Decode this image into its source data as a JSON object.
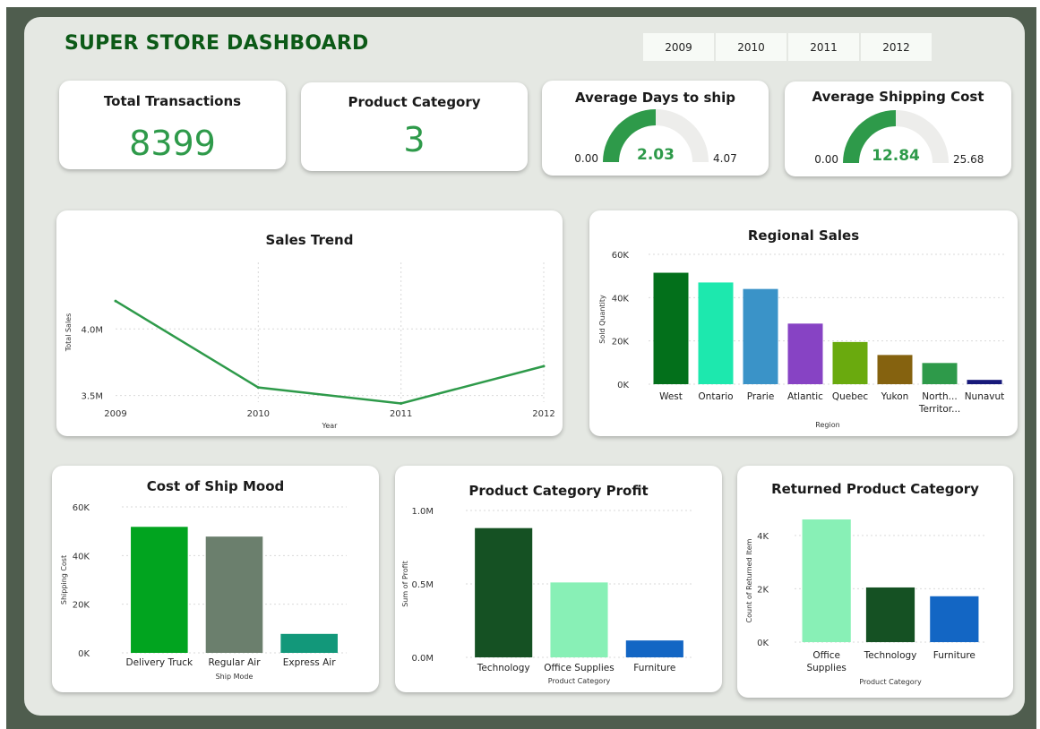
{
  "header": {
    "title": "SUPER STORE DASHBOARD",
    "years": [
      "2009",
      "2010",
      "2011",
      "2012"
    ]
  },
  "kpis": {
    "total_transactions": {
      "label": "Total Transactions",
      "value": "8399"
    },
    "product_category": {
      "label": "Product Category",
      "value": "3"
    },
    "avg_days_to_ship": {
      "label": "Average Days to ship",
      "value": "2.03",
      "min": "0.00",
      "max": "4.07",
      "fraction": 0.5
    },
    "avg_shipping_cost": {
      "label": "Average Shipping Cost",
      "value": "12.84",
      "min": "0.00",
      "max": "25.68",
      "fraction": 0.5
    }
  },
  "colors": {
    "accent": "#2e9a4a",
    "title": "#0c5a17",
    "frame": "#4f5d4e",
    "canvas": "#e5e8e3"
  },
  "chart_data": [
    {
      "id": "sales_trend",
      "type": "line",
      "title": "Sales Trend",
      "xlabel": "Year",
      "ylabel": "Total Sales",
      "x": [
        "2009",
        "2010",
        "2011",
        "2012"
      ],
      "values": [
        4.21,
        3.56,
        3.44,
        3.72
      ],
      "ylim": [
        3.45,
        4.5
      ],
      "yticks": [
        {
          "v": 3.5,
          "label": "3.5M"
        },
        {
          "v": 4.0,
          "label": "4.0M"
        }
      ],
      "color": "#2e9a4a",
      "grid": true
    },
    {
      "id": "regional_sales",
      "type": "bar",
      "title": "Regional Sales",
      "xlabel": "Region",
      "ylabel": "Sold Quantity",
      "categories": [
        "West",
        "Ontario",
        "Prarie",
        "Atlantic",
        "Quebec",
        "Yukon",
        "North... Territor...",
        "Nunavut"
      ],
      "values": [
        51500,
        47000,
        44000,
        28000,
        19500,
        13500,
        9800,
        2000
      ],
      "colors": [
        "#03701b",
        "#1de8ae",
        "#3a93c8",
        "#8743c4",
        "#6aaa0e",
        "#85620f",
        "#2e9a4a",
        "#17197a"
      ],
      "ylim": [
        0,
        60000
      ],
      "yticks": [
        {
          "v": 0,
          "label": "0K"
        },
        {
          "v": 20000,
          "label": "20K"
        },
        {
          "v": 40000,
          "label": "40K"
        },
        {
          "v": 60000,
          "label": "60K"
        }
      ]
    },
    {
      "id": "cost_of_ship_mode",
      "type": "bar",
      "title": "Cost of Ship Mood",
      "xlabel": "Ship Mode",
      "ylabel": "Shipping Cost",
      "categories": [
        "Delivery Truck",
        "Regular Air",
        "Express Air"
      ],
      "values": [
        51800,
        47800,
        7800
      ],
      "colors": [
        "#01a41f",
        "#6b7f6d",
        "#12987a"
      ],
      "ylim": [
        0,
        60000
      ],
      "yticks": [
        {
          "v": 0,
          "label": "0K"
        },
        {
          "v": 20000,
          "label": "20K"
        },
        {
          "v": 40000,
          "label": "40K"
        },
        {
          "v": 60000,
          "label": "60K"
        }
      ]
    },
    {
      "id": "product_category_profit",
      "type": "bar",
      "title": "Product Category Profit",
      "xlabel": "Product Category",
      "ylabel": "Sum of Profit",
      "categories": [
        "Technology",
        "Office Supplies",
        "Furniture"
      ],
      "values": [
        880000,
        510000,
        115000
      ],
      "colors": [
        "#155123",
        "#88f0b6",
        "#1366c4"
      ],
      "ylim": [
        0,
        1000000
      ],
      "yticks": [
        {
          "v": 0,
          "label": "0.0M"
        },
        {
          "v": 500000,
          "label": "0.5M"
        },
        {
          "v": 1000000,
          "label": "1.0M"
        }
      ]
    },
    {
      "id": "returned_product_category",
      "type": "bar",
      "title": "Returned Product Category",
      "xlabel": "Product Category",
      "ylabel": "Count of Returned Item",
      "categories": [
        "Office Supplies",
        "Technology",
        "Furniture"
      ],
      "values": [
        4600,
        2050,
        1720
      ],
      "colors": [
        "#88f0b6",
        "#155123",
        "#1366c4"
      ],
      "ylim": [
        0,
        4600
      ],
      "yticks": [
        {
          "v": 0,
          "label": "0K"
        },
        {
          "v": 2000,
          "label": "2K"
        },
        {
          "v": 4000,
          "label": "4K"
        }
      ]
    }
  ]
}
